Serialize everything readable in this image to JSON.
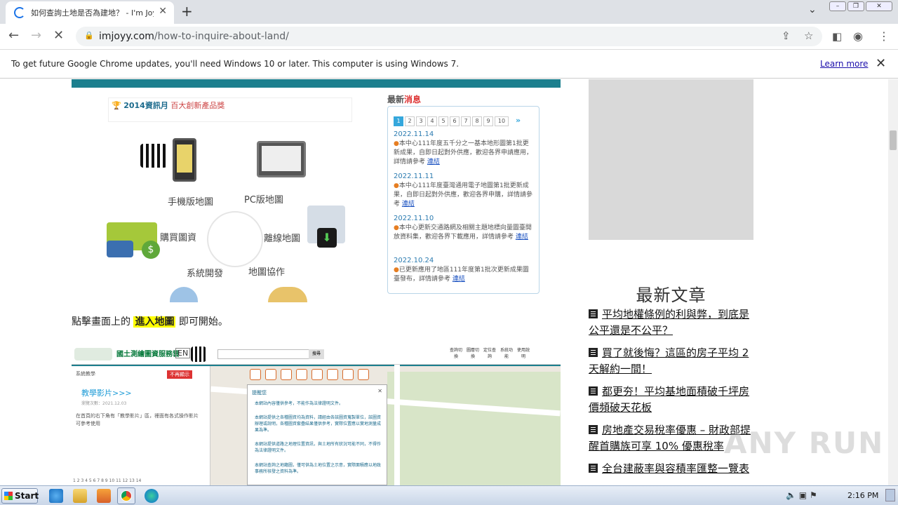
{
  "browser": {
    "tab_title": "如何查詢土地是否為建地？ - I'm Joyy",
    "url_host": "imjoyy.com",
    "url_path": "/how-to-inquire-about-land/",
    "infobar_message": "To get future Google Chrome updates, you'll need Windows 10 or later. This computer is using Windows 7.",
    "infobar_link": "Learn more"
  },
  "figure1": {
    "award": "2014資訊月",
    "award_suffix": "百大創新產品獎",
    "features": [
      "手機版地圖",
      "PC版地圖",
      "購買圖資",
      "離線地圖",
      "系統開發",
      "地圖協作"
    ],
    "news_title_a": "最新",
    "news_title_b": "消息",
    "pages": [
      "1",
      "2",
      "3",
      "4",
      "5",
      "6",
      "7",
      "8",
      "9",
      "10"
    ],
    "news": [
      {
        "date": "2022.11.14",
        "text": "本中心111年度五千分之一基本地形圖第1批更新成果，自即日起對外供應，歡迎各界申請應用，詳情請參考",
        "link": "連結"
      },
      {
        "date": "2022.11.11",
        "text": "本中心111年度臺灣通用電子地圖第1批更新成果，自即日起對外供應，歡迎各界申購，詳情請參考",
        "link": "連結"
      },
      {
        "date": "2022.11.10",
        "text": "本中心更新交通路網及相關主題地標向量圖臺開放資料集，歡迎各界下載應用，詳情請參考",
        "link": "連結"
      },
      {
        "date": "2022.10.24",
        "text": "已更新應用了地區111年度第1批次更新成果圖臺發布，詳情請參考",
        "link": "連結"
      }
    ]
  },
  "instruction": {
    "before": "點擊畫面上的",
    "highlight": "進入地圖",
    "after": "即可開始。"
  },
  "figure2": {
    "logo": "國土測繪圖資服務雲",
    "en": "EN",
    "search_btn": "搜尋",
    "side_title": "系統教學",
    "side_btn": "不再顯示",
    "video_title": "教學影片>>>",
    "video_meta": "瀏覽次數：2021.12.03",
    "side_desc": "在首頁的右下角有「教學影片」區，裡面有各式操作影片可參考使用",
    "dialog_title": "提醒您",
    "dialog_lines": [
      "本網站內容僅供參考，不能作為法律證明文件。",
      "本網站提供之各種圖資均為資料，請經由各該圖資蒐製單位，該圖資辦理或說明，各種圖資套疊結果僅供參考，實際位置應以實地測量成果為準。",
      "本網站提供道路之地理位置資訊，與土地所有狀況可能不同，不得作為法律證明文件。",
      "本網站查詢之地籍圖，僅可供為土地位置之示意，實際面積應以地政事務所核發之資料為準。"
    ],
    "right_icons": [
      "查詢切換",
      "圖層切換",
      "定位查詢",
      "系統功能",
      "使用說明"
    ],
    "pager": "1 2 3 4 5 6 7 8 9 10 11 12 13 14"
  },
  "sidebar": {
    "latest_heading": "最新文章",
    "articles": [
      "平均地權條例的利與弊，到底是公平還是不公平？",
      "買了就後悔？這區的房子平均 2 天解約一間！",
      "都更夯！平均基地面積破千坪房價頻破天花板",
      "房地產交易稅率優惠 – 財政部提醒首購族可享 10% 優惠稅率",
      "全台建蔽率與容積率匯整一覽表"
    ]
  },
  "watermark": "ANY RUN",
  "taskbar": {
    "start": "Start",
    "clock": "2:16 PM",
    "icons": [
      "ie-icon",
      "explorer-icon",
      "media-player-icon",
      "chrome-icon",
      "edge-icon"
    ]
  },
  "colors": {
    "teal_band": "#1c7f8e",
    "highlight": "#ffff00",
    "link_blue": "#1a0dab",
    "ad_gray": "#d9d9d9"
  }
}
